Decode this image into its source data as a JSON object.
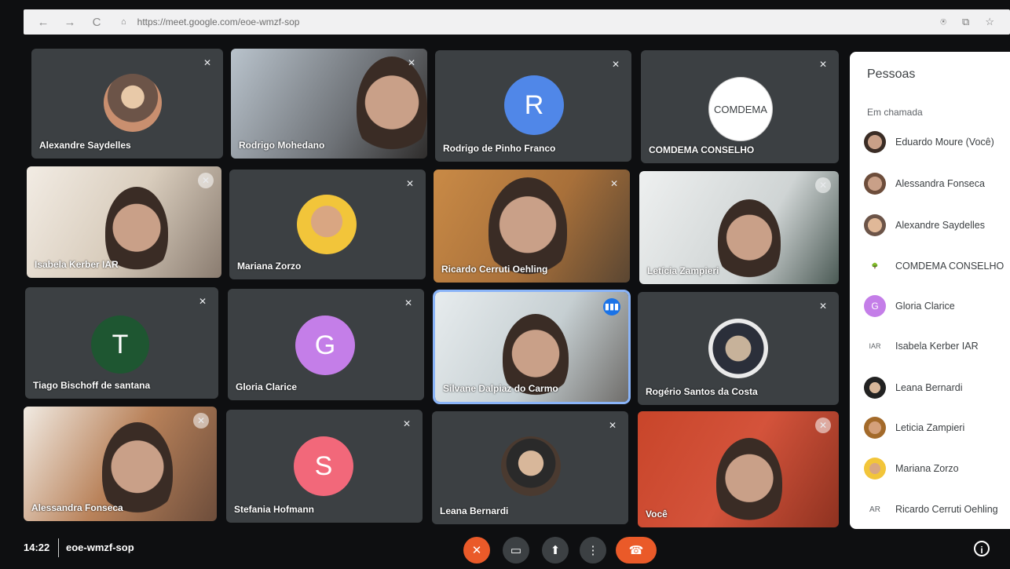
{
  "browser": {
    "url": "https://meet.google.com/eoe-wmzf-sop",
    "back_icon": "←",
    "forward_icon": "→",
    "reload_icon": "C",
    "lock_icon": "🔒",
    "mic_icon": "🎙",
    "tab_icon": "⧉",
    "star_icon": "☆"
  },
  "tiles": [
    {
      "name": "Alexandre Saydelles"
    },
    {
      "name": "Rodrigo Mohedano"
    },
    {
      "name": "Rodrigo de Pinho Franco",
      "letter": "R"
    },
    {
      "name": "COMDEMA CONSELHO",
      "logo": "COMDEMA"
    },
    {
      "name": "Isabela Kerber IAR"
    },
    {
      "name": "Mariana Zorzo"
    },
    {
      "name": "Ricardo Cerruti Oehling"
    },
    {
      "name": "Letícia Zampieri"
    },
    {
      "name": "Tiago Bischoff de santana",
      "letter": "T"
    },
    {
      "name": "Gloria Clarice",
      "letter": "G"
    },
    {
      "name": "Silvane Dalpiaz do Carmo"
    },
    {
      "name": "Rogério Santos da Costa"
    },
    {
      "name": "Alessandra Fonseca"
    },
    {
      "name": "Stefania Hofmann",
      "letter": "S"
    },
    {
      "name": "Leana Bernardi"
    },
    {
      "name": "Você"
    }
  ],
  "mic_off_icon": "🎙̸",
  "people_panel": {
    "title": "Pessoas",
    "section": "Em chamada",
    "people": [
      {
        "name": "Eduardo Moure (Você)"
      },
      {
        "name": "Alessandra Fonseca"
      },
      {
        "name": "Alexandre Saydelles"
      },
      {
        "name": "COMDEMA CONSELHO"
      },
      {
        "name": "Gloria Clarice",
        "letter": "G"
      },
      {
        "name": "Isabela Kerber IAR",
        "logo": "IAR"
      },
      {
        "name": "Leana Bernardi"
      },
      {
        "name": "Leticia Zampieri"
      },
      {
        "name": "Mariana Zorzo"
      },
      {
        "name": "Ricardo Cerruti Oehling",
        "logo": "AR"
      }
    ]
  },
  "bottom": {
    "time": "14:22",
    "meeting_code": "eoe-wmzf-sop",
    "info_icon": "i"
  },
  "colors": {
    "tile_bg": "#3c4043",
    "mic_red": "#ea5a29",
    "hangup_red": "#ea5a29",
    "control_gray": "#3c4043",
    "avatar_blue": "#5087e8",
    "avatar_green": "#1e5631",
    "avatar_purple": "#c47ee8",
    "avatar_pink": "#f2687a"
  }
}
